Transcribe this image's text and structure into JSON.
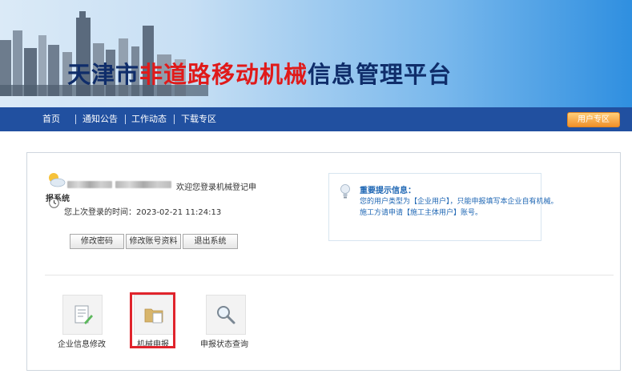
{
  "header": {
    "title_prefix": "天津市",
    "title_highlight": "非道路移动机械",
    "title_suffix": "信息管理平台"
  },
  "nav": {
    "items": [
      "首页",
      "通知公告",
      "工作动态",
      "下载专区"
    ],
    "user_zone": "用户专区"
  },
  "user_panel": {
    "welcome": "欢迎您登录机械登记申",
    "welcome_cont": "报系统",
    "last_login": "您上次登录的时间：2023-02-21 11:24:13",
    "buttons": [
      "修改密码",
      "修改账号资料",
      "退出系统"
    ]
  },
  "notice": {
    "title": "重要提示信息：",
    "line1": "您的用户类型为【企业用户】，只能申报填写本企业自有机械。",
    "line2": "施工方请申请【施工主体用户】账号。"
  },
  "shortcuts": [
    {
      "label": "企业信息修改",
      "icon": "document-edit-icon"
    },
    {
      "label": "机械申报",
      "icon": "folder-icon"
    },
    {
      "label": "申报状态查询",
      "icon": "magnifier-icon"
    }
  ],
  "colors": {
    "nav_bg": "#2150a0",
    "title_dark": "#0f2d6a",
    "title_red": "#e01a1a",
    "notice_blue": "#1f67b4",
    "highlight": "#e0242c",
    "user_zone": "#f0902a"
  }
}
